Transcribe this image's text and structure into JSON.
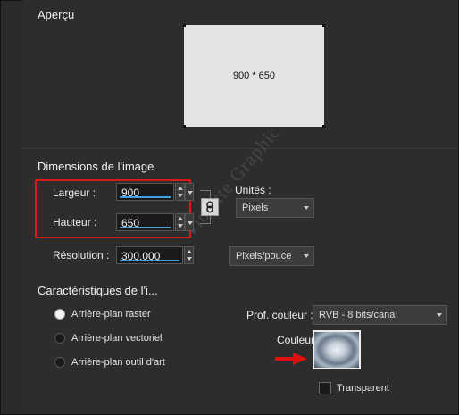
{
  "preview": {
    "title": "Aperçu",
    "size_text": "900 * 650"
  },
  "dimensions": {
    "title": "Dimensions de l'image",
    "width_label": "Largeur :",
    "width_value": "900",
    "height_label": "Hauteur :",
    "height_value": "650",
    "resolution_label": "Résolution :",
    "resolution_value": "300,000",
    "units_label": "Unités :",
    "units_value": "Pixels",
    "resolution_units_value": "Pixels/pouce"
  },
  "characteristics": {
    "title": "Caractéristiques de l'i...",
    "background_options": [
      {
        "label": "Arrière-plan raster",
        "selected": true
      },
      {
        "label": "Arrière-plan vectoriel",
        "selected": false
      },
      {
        "label": "Arrière-plan outil d'art",
        "selected": false
      }
    ],
    "color_depth_label": "Prof. couleur :",
    "color_depth_value": "RVB - 8 bits/canal",
    "color_label": "Couleur :",
    "transparent_label": "Transparent",
    "transparent_checked": false
  },
  "watermark": "Violette Graphic",
  "colors": {
    "highlight_border": "#d91a1a",
    "arrow": "#e01010",
    "field_underline": "#3fa0e0"
  }
}
